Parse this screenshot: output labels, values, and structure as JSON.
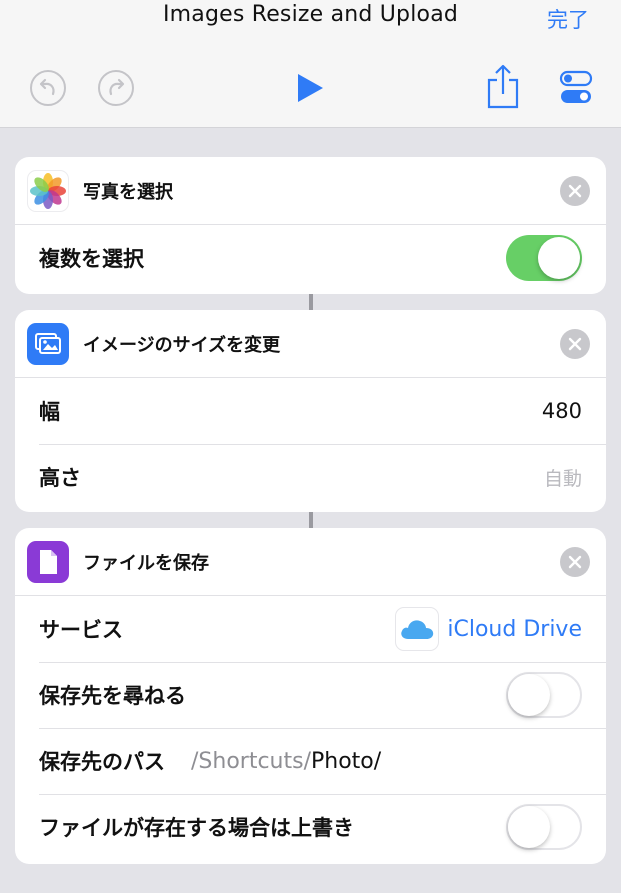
{
  "nav": {
    "title": "Images Resize and Upload",
    "done_label": "完了"
  },
  "colors": {
    "accent": "#2f7bf6",
    "toggle_on": "#67cf66",
    "background": "#e3e3e8"
  },
  "actions": [
    {
      "title": "写真を選択",
      "icon": "photos-icon",
      "rows": [
        {
          "label": "複数を選択",
          "toggle": true
        }
      ]
    },
    {
      "title": "イメージのサイズを変更",
      "icon": "resize-image-icon",
      "rows": [
        {
          "label": "幅",
          "value": "480"
        },
        {
          "label": "高さ",
          "placeholder": "自動"
        }
      ]
    },
    {
      "title": "ファイルを保存",
      "icon": "document-icon",
      "rows": [
        {
          "label": "サービス",
          "value": "iCloud Drive",
          "icon": "icloud-icon"
        },
        {
          "label": "保存先を尋ねる",
          "toggle": false
        },
        {
          "label": "保存先のパス",
          "path_prefix": "/Shortcuts/",
          "path_suffix": "Photo/"
        },
        {
          "label": "ファイルが存在する場合は上書き",
          "toggle": false
        }
      ]
    }
  ]
}
